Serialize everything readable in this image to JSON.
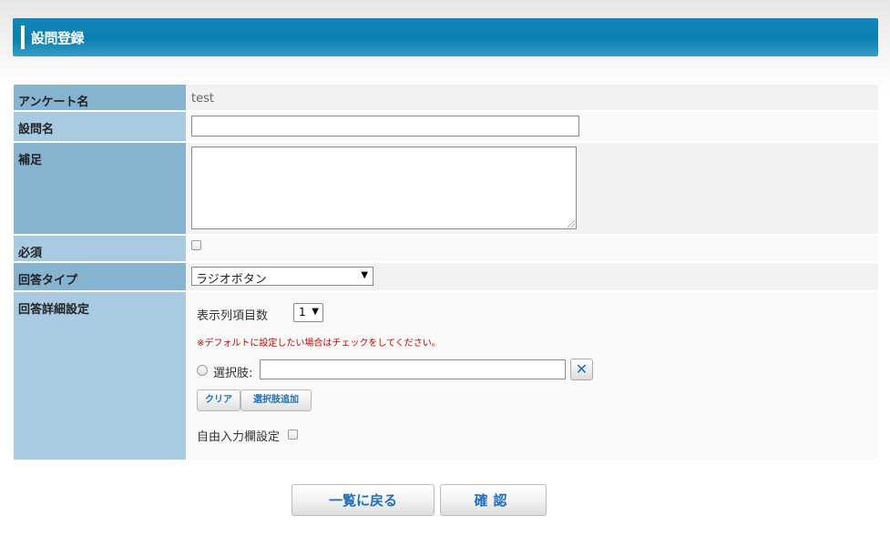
{
  "page": {
    "title": "設問登録"
  },
  "form": {
    "survey_name": {
      "label": "アンケート名",
      "value": "test"
    },
    "question_name": {
      "label": "設問名",
      "value": ""
    },
    "supplement": {
      "label": "補足",
      "value": ""
    },
    "required": {
      "label": "必須",
      "checked": false
    },
    "answer_type": {
      "label": "回答タイプ",
      "selected": "ラジオボタン",
      "arrow": "▼"
    },
    "answer_details": {
      "label": "回答詳細設定",
      "columns_label": "表示列項目数",
      "columns_value": "1",
      "note": "※デフォルトに設定したい場合はチェックをしてください。",
      "choice_label": "選択肢:",
      "choice_value": "",
      "delete_icon_glyph": "✕",
      "clear_button": "クリア",
      "add_choice_button": "選択肢追加",
      "free_input_label": "自由入力欄設定"
    }
  },
  "buttons": {
    "back": "一覧に戻る",
    "confirm": "確認"
  },
  "colors": {
    "header": "#0c7fb0",
    "label_dark": "#86b3d0",
    "label_light": "#a9cbe2",
    "button_text": "#1f6fb6",
    "note_red": "#cc0000"
  }
}
